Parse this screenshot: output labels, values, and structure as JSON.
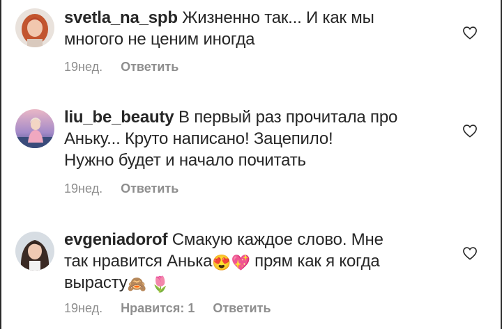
{
  "comments": [
    {
      "username": "svetla_na_spb",
      "text_lines": [
        "Жизненно так... И как мы",
        "многого не ценим иногда"
      ],
      "time": "19нед.",
      "reply_label": "Ответить",
      "avatar_icon": "avatar-redhead-woman",
      "like_icon": "heart-outline-icon"
    },
    {
      "username": "liu_be_beauty",
      "text_lines": [
        "В первый раз прочитала про",
        "Аньку... Круто написано! Зацепило!",
        "Нужно будет и начало почитать"
      ],
      "time": "19нед.",
      "reply_label": "Ответить",
      "avatar_icon": "avatar-woman-sunset",
      "like_icon": "heart-outline-icon"
    },
    {
      "username": "evgeniadorof",
      "text_line1": "Смакую каждое слово. Мне",
      "text_line2_a": "так нравится Анька",
      "text_line2_b": "прям как я когда",
      "text_line3": "вырасту",
      "emojis": [
        "😍",
        "💖",
        "🙈",
        "🌷"
      ],
      "time": "19нед.",
      "likes_label": "Нравится: 1",
      "reply_label": "Ответить",
      "avatar_icon": "avatar-dark-hair-woman",
      "like_icon": "heart-outline-icon"
    }
  ],
  "colors": {
    "text": "#262626",
    "meta": "#8e8e8e",
    "background": "#ffffff"
  }
}
